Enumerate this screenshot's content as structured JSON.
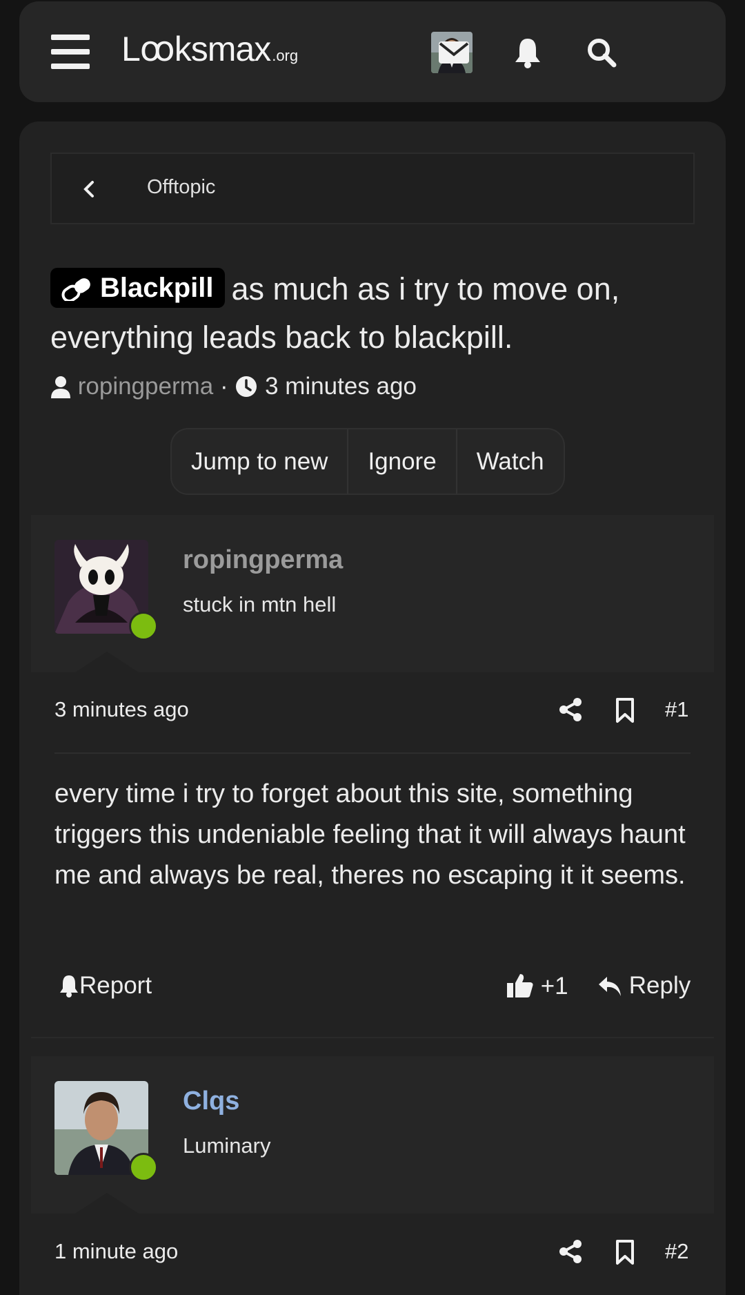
{
  "header": {
    "logo_main": "Lꝏksmax",
    "logo_suffix": ".org"
  },
  "breadcrumb": {
    "label": "Offtopic"
  },
  "thread": {
    "prefix": "Blackpill",
    "title": "as much as i try to move on, everything leads back to blackpill.",
    "author": "ropingperma",
    "separator": "·",
    "time": "3 minutes ago"
  },
  "actions": {
    "jump": "Jump to new",
    "ignore": "Ignore",
    "watch": "Watch"
  },
  "posts": [
    {
      "username": "ropingperma",
      "user_title": "stuck in mtn hell",
      "time": "3 minutes ago",
      "number": "#1",
      "body": "every time i try to forget about this site, something triggers this undeniable feeling that it will always haunt me and always be real, theres no escaping it it seems.",
      "report": "Report",
      "reaction": "+1",
      "reply": "Reply"
    },
    {
      "username": "Clqs",
      "user_title": "Luminary",
      "time": "1 minute ago",
      "number": "#2"
    }
  ],
  "colors": {
    "background": "#141414",
    "card": "#222222",
    "online": "#7cbc10",
    "username_link": "#8fb1e0"
  }
}
